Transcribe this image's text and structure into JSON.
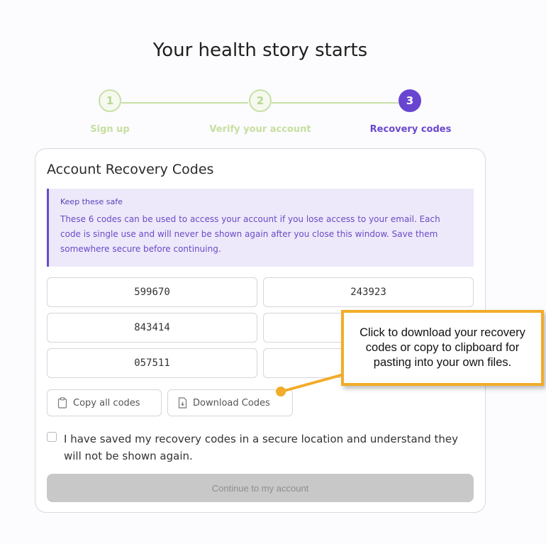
{
  "page": {
    "title": "Your health story starts"
  },
  "stepper": {
    "steps": [
      {
        "number": "1",
        "label": "Sign up"
      },
      {
        "number": "2",
        "label": "Verify your account"
      },
      {
        "number": "3",
        "label": "Recovery codes"
      }
    ],
    "active_step": 3,
    "colors": {
      "done": "#c8e0a8",
      "active": "#6845d1"
    }
  },
  "card": {
    "title": "Account Recovery Codes",
    "notice": {
      "heading": "Keep these safe",
      "body": "These 6 codes can be used to access your account if you lose access to your email. Each code is single use and will never be shown again after you close this window. Save them somewhere secure before continuing."
    },
    "codes": [
      "599670",
      "243923",
      "843414",
      "",
      "057511",
      ""
    ],
    "buttons": {
      "copy_label": "Copy all codes",
      "copy_icon": "clipboard-icon",
      "download_label": "Download Codes",
      "download_icon": "file-download-icon"
    },
    "checkbox": {
      "label": "I have saved my recovery codes in a secure location and understand they will not be shown again."
    },
    "continue_label": "Continue to my account"
  },
  "callout": {
    "text": "Click to download your recovery codes or copy to clipboard for pasting into your own files.",
    "color": "#f2ac2a"
  }
}
